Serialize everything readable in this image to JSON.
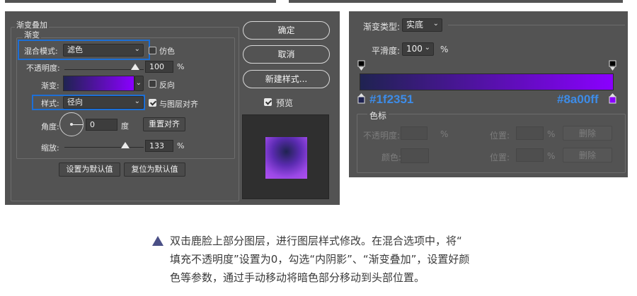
{
  "left_dialog": {
    "group_title": "渐变叠加",
    "subgroup_title": "渐变",
    "blend_mode_label": "混合模式:",
    "blend_mode_value": "滤色",
    "dither_label": "仿色",
    "opacity_label": "不透明度:",
    "opacity_value": "100",
    "opacity_unit": "%",
    "gradient_label": "渐变:",
    "reverse_label": "反向",
    "style_label": "样式:",
    "style_value": "径向",
    "align_label": "与图层对齐",
    "angle_label": "角度:",
    "angle_value": "0",
    "angle_unit": "度",
    "reset_align_label": "重置对齐",
    "scale_label": "缩放:",
    "scale_value": "133",
    "scale_unit": "%",
    "set_default_label": "设置为默认值",
    "reset_default_label": "复位为默认值",
    "ok_label": "确定",
    "cancel_label": "取消",
    "new_style_label": "新建样式...",
    "preview_label": "预览",
    "gradient_start_color": "#1f2351",
    "gradient_end_color": "#8a00ff",
    "dither_checked": false,
    "reverse_checked": false,
    "align_checked": true,
    "preview_checked": true
  },
  "right_dialog": {
    "gradient_type_label": "渐变类型:",
    "gradient_type_value": "实底",
    "smoothness_label": "平滑度:",
    "smoothness_value": "100",
    "smoothness_unit": "%",
    "start_color_text": "#1f2351",
    "end_color_text": "#8a00ff",
    "stops_title": "色标",
    "stop_opacity_label": "不透明度:",
    "stop_opacity_unit": "%",
    "position_label_1": "位置:",
    "position_unit_1": "%",
    "delete_label_1": "删除",
    "color_label": "颜色:",
    "position_label_2": "位置:",
    "position_unit_2": "%",
    "delete_label_2": "删除",
    "annotation_color": "#3d8ce8"
  },
  "caption": {
    "line1": "双击鹿脸上部分图层，进行图层样式修改。在混合选项中，将“",
    "line2": "填充不透明度”设置为0，勾选“内阴影”、“渐变叠加”，设置好颜",
    "line3": "色等参数，通过手动移动将暗色部分移动到头部位置。",
    "bullet_color": "#4a4f86"
  }
}
